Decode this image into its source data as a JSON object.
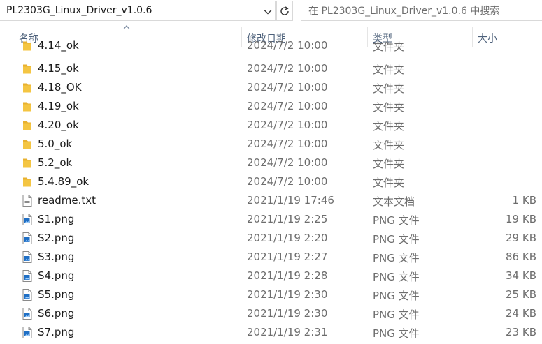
{
  "address_bar": {
    "path": "PL2303G_Linux_Driver_v1.0.6"
  },
  "search": {
    "placeholder": "在 PL2303G_Linux_Driver_v1.0.6 中搜索"
  },
  "columns": {
    "name": "名称",
    "date": "修改日期",
    "type": "类型",
    "size": "大小"
  },
  "colors": {
    "folder": "#f4c542",
    "header_text": "#4c607a",
    "muted_text": "#6d6d6d",
    "png_icon": "#1f6fc5"
  },
  "files": [
    {
      "name": "4.14_ok",
      "date": "2024/7/2 10:00",
      "type": "文件夹",
      "size": "",
      "icon": "folder-icon"
    },
    {
      "name": "4.15_ok",
      "date": "2024/7/2 10:00",
      "type": "文件夹",
      "size": "",
      "icon": "folder-icon"
    },
    {
      "name": "4.18_OK",
      "date": "2024/7/2 10:00",
      "type": "文件夹",
      "size": "",
      "icon": "folder-icon"
    },
    {
      "name": "4.19_ok",
      "date": "2024/7/2 10:00",
      "type": "文件夹",
      "size": "",
      "icon": "folder-icon"
    },
    {
      "name": "4.20_ok",
      "date": "2024/7/2 10:00",
      "type": "文件夹",
      "size": "",
      "icon": "folder-icon"
    },
    {
      "name": "5.0_ok",
      "date": "2024/7/2 10:00",
      "type": "文件夹",
      "size": "",
      "icon": "folder-icon"
    },
    {
      "name": "5.2_ok",
      "date": "2024/7/2 10:00",
      "type": "文件夹",
      "size": "",
      "icon": "folder-icon"
    },
    {
      "name": "5.4.89_ok",
      "date": "2024/7/2 10:00",
      "type": "文件夹",
      "size": "",
      "icon": "folder-icon"
    },
    {
      "name": "readme.txt",
      "date": "2021/1/19 17:46",
      "type": "文本文档",
      "size": "1 KB",
      "icon": "text-file-icon"
    },
    {
      "name": "S1.png",
      "date": "2021/1/19 2:25",
      "type": "PNG 文件",
      "size": "19 KB",
      "icon": "png-file-icon"
    },
    {
      "name": "S2.png",
      "date": "2021/1/19 2:20",
      "type": "PNG 文件",
      "size": "29 KB",
      "icon": "png-file-icon"
    },
    {
      "name": "S3.png",
      "date": "2021/1/19 2:27",
      "type": "PNG 文件",
      "size": "86 KB",
      "icon": "png-file-icon"
    },
    {
      "name": "S4.png",
      "date": "2021/1/19 2:28",
      "type": "PNG 文件",
      "size": "34 KB",
      "icon": "png-file-icon"
    },
    {
      "name": "S5.png",
      "date": "2021/1/19 2:30",
      "type": "PNG 文件",
      "size": "25 KB",
      "icon": "png-file-icon"
    },
    {
      "name": "S6.png",
      "date": "2021/1/19 2:30",
      "type": "PNG 文件",
      "size": "24 KB",
      "icon": "png-file-icon"
    },
    {
      "name": "S7.png",
      "date": "2021/1/19 2:31",
      "type": "PNG 文件",
      "size": "23 KB",
      "icon": "png-file-icon"
    }
  ]
}
